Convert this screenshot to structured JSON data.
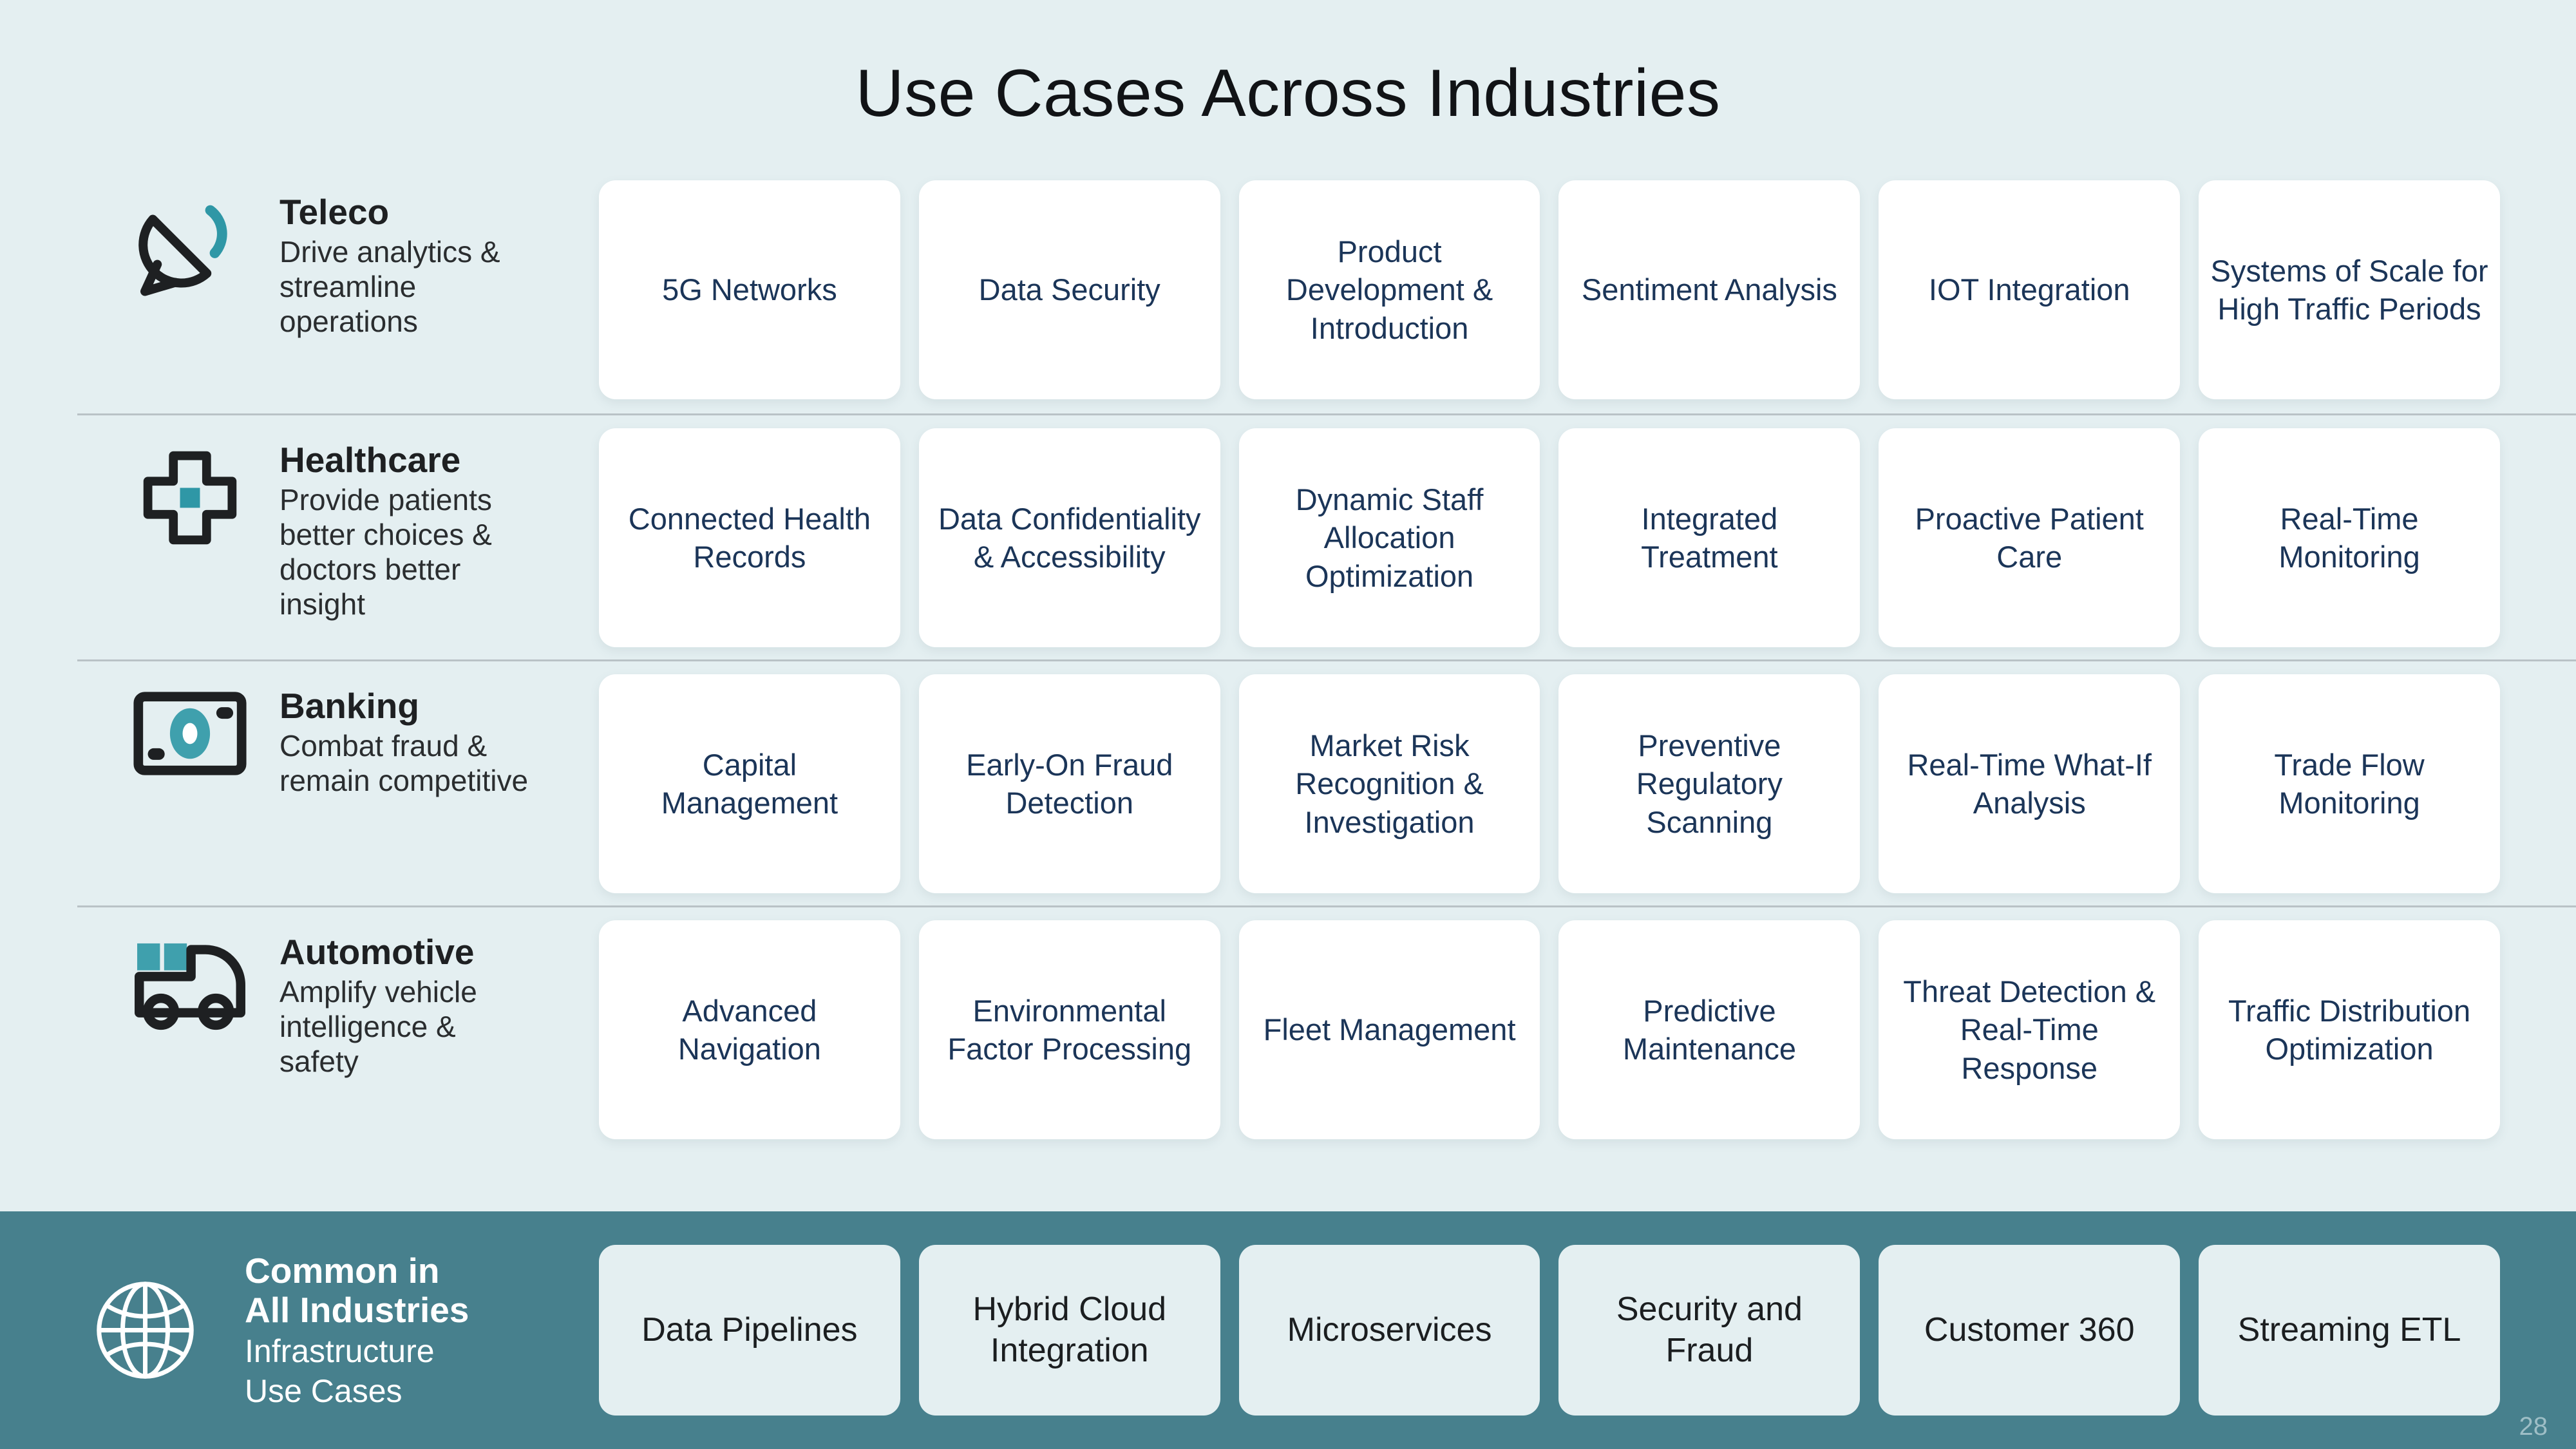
{
  "title": "Use Cases Across Industries",
  "page_number": "28",
  "colors": {
    "background": "#E4EFF1",
    "banner": "#47808D",
    "card": "#FFFFFF",
    "card_text": "#1B3558",
    "accent_teal": "#2F97A6",
    "icon_dark": "#1E2022",
    "separator": "#B9C2C6",
    "page_number": "#9EBEC6"
  },
  "rows": [
    {
      "icon": "satellite-dish-icon",
      "name": "Teleco",
      "description": "Drive analytics & streamline operations",
      "cards": [
        "5G Networks",
        "Data Security",
        "Product Development & Introduction",
        "Sentiment Analysis",
        "IOT Integration",
        "Systems of Scale for High Traffic Periods"
      ]
    },
    {
      "icon": "medical-cross-icon",
      "name": "Healthcare",
      "description": "Provide patients better choices & doctors better insight",
      "cards": [
        "Connected Health Records",
        "Data Confidentiality & Accessibility",
        "Dynamic Staff Allocation Optimization",
        "Integrated Treatment",
        "Proactive Patient Care",
        "Real-Time Monitoring"
      ]
    },
    {
      "icon": "banknote-icon",
      "name": "Banking",
      "description": "Combat fraud & remain competitive",
      "cards": [
        "Capital Management",
        "Early-On Fraud Detection",
        "Market Risk Recognition & Investigation",
        "Preventive Regulatory Scanning",
        "Real-Time What-If Analysis",
        "Trade Flow Monitoring"
      ]
    },
    {
      "icon": "delivery-truck-icon",
      "name": "Automotive",
      "description": "Amplify vehicle intelligence & safety",
      "cards": [
        "Advanced Navigation",
        "Environmental Factor Processing",
        "Fleet Management",
        "Predictive Maintenance",
        "Threat Detection & Real-Time Response",
        "Traffic Distribution Optimization"
      ]
    }
  ],
  "banner": {
    "icon": "globe-icon",
    "title_line1": "Common in",
    "title_line2": "All Industries",
    "subtitle_line1": "Infrastructure",
    "subtitle_line2": "Use Cases",
    "cards": [
      "Data Pipelines",
      "Hybrid Cloud Integration",
      "Microservices",
      "Security and Fraud",
      "Customer 360",
      "Streaming ETL"
    ]
  }
}
